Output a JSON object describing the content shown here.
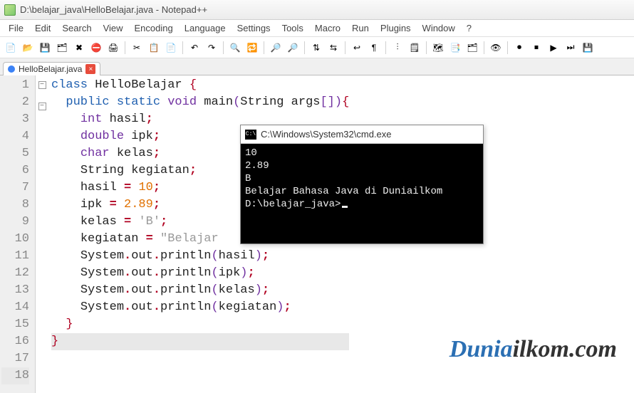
{
  "window": {
    "title": "D:\\belajar_java\\HelloBelajar.java - Notepad++"
  },
  "menu": {
    "items": [
      "File",
      "Edit",
      "Search",
      "View",
      "Encoding",
      "Language",
      "Settings",
      "Tools",
      "Macro",
      "Run",
      "Plugins",
      "Window",
      "?"
    ]
  },
  "toolbar": {
    "icons": [
      {
        "name": "new-file-icon",
        "glyph": "📄"
      },
      {
        "name": "open-folder-icon",
        "glyph": "📂"
      },
      {
        "name": "save-icon",
        "glyph": "💾"
      },
      {
        "name": "save-all-icon",
        "glyph": "🗂"
      },
      {
        "name": "close-icon",
        "glyph": "✖"
      },
      {
        "name": "close-all-icon",
        "glyph": "⛔"
      },
      {
        "name": "print-icon",
        "glyph": "🖨"
      },
      {
        "sep": true
      },
      {
        "name": "cut-icon",
        "glyph": "✂"
      },
      {
        "name": "copy-icon",
        "glyph": "📋"
      },
      {
        "name": "paste-icon",
        "glyph": "📄"
      },
      {
        "sep": true
      },
      {
        "name": "undo-icon",
        "glyph": "↶"
      },
      {
        "name": "redo-icon",
        "glyph": "↷"
      },
      {
        "sep": true
      },
      {
        "name": "find-icon",
        "glyph": "🔍"
      },
      {
        "name": "replace-icon",
        "glyph": "🔁"
      },
      {
        "sep": true
      },
      {
        "name": "zoom-in-icon",
        "glyph": "🔎"
      },
      {
        "name": "zoom-out-icon",
        "glyph": "🔎"
      },
      {
        "sep": true
      },
      {
        "name": "sync-v-icon",
        "glyph": "⇅"
      },
      {
        "name": "sync-h-icon",
        "glyph": "⇆"
      },
      {
        "sep": true
      },
      {
        "name": "wordwrap-icon",
        "glyph": "↩"
      },
      {
        "name": "all-chars-icon",
        "glyph": "¶"
      },
      {
        "sep": true
      },
      {
        "name": "indent-guide-icon",
        "glyph": "⫶"
      },
      {
        "name": "lang-udl-icon",
        "glyph": "🗒"
      },
      {
        "sep": true
      },
      {
        "name": "doc-map-icon",
        "glyph": "🗺"
      },
      {
        "name": "func-list-icon",
        "glyph": "📑"
      },
      {
        "name": "folder-tree-icon",
        "glyph": "🗂"
      },
      {
        "sep": true
      },
      {
        "name": "monitor-icon",
        "glyph": "👁"
      },
      {
        "sep": true
      },
      {
        "name": "record-macro-icon",
        "glyph": "⏺"
      },
      {
        "name": "stop-macro-icon",
        "glyph": "⏹"
      },
      {
        "name": "play-macro-icon",
        "glyph": "▶"
      },
      {
        "name": "play-multi-icon",
        "glyph": "⏭"
      },
      {
        "name": "save-macro-icon",
        "glyph": "💾"
      }
    ]
  },
  "tab": {
    "label": "HelloBelajar.java",
    "close": "×"
  },
  "code": {
    "lines": [
      {
        "n": "1",
        "frags": [
          [
            "kw-def",
            "class "
          ],
          [
            "ident",
            "HelloBelajar "
          ],
          [
            "paren",
            "{"
          ]
        ]
      },
      {
        "n": "2",
        "frags": [
          [
            "",
            "  "
          ],
          [
            "kw-mod",
            "public static "
          ],
          [
            "kw-type",
            "void "
          ],
          [
            "ident",
            "main"
          ],
          [
            "paren2",
            "("
          ],
          [
            "ident",
            "String args"
          ],
          [
            "paren2",
            "[]"
          ],
          [
            "paren2",
            ")"
          ],
          [
            "paren",
            "{"
          ]
        ]
      },
      {
        "n": "3",
        "frags": [
          [
            "",
            "    "
          ],
          [
            "kw-type",
            "int "
          ],
          [
            "ident",
            "hasil"
          ],
          [
            "op",
            ";"
          ]
        ]
      },
      {
        "n": "4",
        "frags": [
          [
            "",
            "    "
          ],
          [
            "kw-type",
            "double "
          ],
          [
            "ident",
            "ipk"
          ],
          [
            "op",
            ";"
          ]
        ]
      },
      {
        "n": "5",
        "frags": [
          [
            "",
            "    "
          ],
          [
            "kw-type",
            "char "
          ],
          [
            "ident",
            "kelas"
          ],
          [
            "op",
            ";"
          ]
        ]
      },
      {
        "n": "6",
        "frags": [
          [
            "",
            "    "
          ],
          [
            "ident",
            "String kegiatan"
          ],
          [
            "op",
            ";"
          ]
        ]
      },
      {
        "n": "7",
        "frags": [
          [
            "",
            ""
          ]
        ]
      },
      {
        "n": "8",
        "frags": [
          [
            "",
            "    "
          ],
          [
            "ident",
            "hasil "
          ],
          [
            "op",
            "= "
          ],
          [
            "num",
            "10"
          ],
          [
            "op",
            ";"
          ]
        ]
      },
      {
        "n": "9",
        "frags": [
          [
            "",
            "    "
          ],
          [
            "ident",
            "ipk "
          ],
          [
            "op",
            "= "
          ],
          [
            "num",
            "2.89"
          ],
          [
            "op",
            ";"
          ]
        ]
      },
      {
        "n": "10",
        "frags": [
          [
            "",
            "    "
          ],
          [
            "ident",
            "kelas "
          ],
          [
            "op",
            "= "
          ],
          [
            "str",
            "'B'"
          ],
          [
            "op",
            ";"
          ]
        ]
      },
      {
        "n": "11",
        "frags": [
          [
            "",
            "    "
          ],
          [
            "ident",
            "kegiatan "
          ],
          [
            "op",
            "= "
          ],
          [
            "str",
            "\"Belajar"
          ]
        ]
      },
      {
        "n": "12",
        "frags": [
          [
            "",
            ""
          ]
        ]
      },
      {
        "n": "13",
        "frags": [
          [
            "",
            "    "
          ],
          [
            "ident",
            "System"
          ],
          [
            "op",
            "."
          ],
          [
            "ident",
            "out"
          ],
          [
            "op",
            "."
          ],
          [
            "ident",
            "println"
          ],
          [
            "paren2",
            "("
          ],
          [
            "ident",
            "hasil"
          ],
          [
            "paren2",
            ")"
          ],
          [
            "op",
            ";"
          ]
        ]
      },
      {
        "n": "14",
        "frags": [
          [
            "",
            "    "
          ],
          [
            "ident",
            "System"
          ],
          [
            "op",
            "."
          ],
          [
            "ident",
            "out"
          ],
          [
            "op",
            "."
          ],
          [
            "ident",
            "println"
          ],
          [
            "paren2",
            "("
          ],
          [
            "ident",
            "ipk"
          ],
          [
            "paren2",
            ")"
          ],
          [
            "op",
            ";"
          ]
        ]
      },
      {
        "n": "15",
        "frags": [
          [
            "",
            "    "
          ],
          [
            "ident",
            "System"
          ],
          [
            "op",
            "."
          ],
          [
            "ident",
            "out"
          ],
          [
            "op",
            "."
          ],
          [
            "ident",
            "println"
          ],
          [
            "paren2",
            "("
          ],
          [
            "ident",
            "kelas"
          ],
          [
            "paren2",
            ")"
          ],
          [
            "op",
            ";"
          ]
        ]
      },
      {
        "n": "16",
        "frags": [
          [
            "",
            "    "
          ],
          [
            "ident",
            "System"
          ],
          [
            "op",
            "."
          ],
          [
            "ident",
            "out"
          ],
          [
            "op",
            "."
          ],
          [
            "ident",
            "println"
          ],
          [
            "paren2",
            "("
          ],
          [
            "ident",
            "kegiatan"
          ],
          [
            "paren2",
            ")"
          ],
          [
            "op",
            ";"
          ]
        ]
      },
      {
        "n": "17",
        "frags": [
          [
            "",
            "  "
          ],
          [
            "paren",
            "}"
          ]
        ]
      },
      {
        "n": "18",
        "frags": [
          [
            "paren",
            "}"
          ]
        ],
        "current": true
      }
    ]
  },
  "cmd": {
    "title": "C:\\Windows\\System32\\cmd.exe",
    "icon": "C:\\",
    "lines": [
      "10",
      "2.89",
      "B",
      "Belajar Bahasa Java di Duniailkom",
      "",
      "D:\\belajar_java>"
    ]
  },
  "watermark": {
    "a": "Dunia",
    "b": "ilkom.com"
  }
}
